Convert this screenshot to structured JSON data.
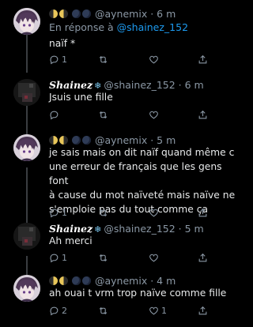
{
  "tweets": [
    {
      "kind": "aynemix",
      "handle": "@aynemix",
      "time": "· 6 m",
      "reply_prefix": "En réponse à ",
      "reply_to": "@shainez_152",
      "text": "naïf *",
      "reply_count": "1",
      "retweet_count": "",
      "like_count": ""
    },
    {
      "kind": "shainez",
      "display_name": "Shainez",
      "handle": "@shainez_152",
      "time": "· 6 m",
      "text": "Jsuis une fille",
      "reply_count": "",
      "retweet_count": "",
      "like_count": ""
    },
    {
      "kind": "aynemix",
      "handle": "@aynemix",
      "time": "· 5 m",
      "lines": [
        "je sais mais on dit naïf quand même c",
        "une erreur de français que les gens font",
        "à cause du mot naïveté mais naïve ne",
        "s'emploie pas du tout comme ça"
      ],
      "reply_count": "1",
      "retweet_count": "",
      "like_count": ""
    },
    {
      "kind": "shainez",
      "display_name": "Shainez",
      "handle": "@shainez_152",
      "time": "· 5 m",
      "text": "Ah merci",
      "reply_count": "1",
      "retweet_count": "",
      "like_count": ""
    },
    {
      "kind": "aynemix",
      "handle": "@aynemix",
      "time": "· 4 m",
      "text": "ah ouai t vrm trop naïve comme fille",
      "reply_count": "2",
      "retweet_count": "",
      "like_count": "1"
    }
  ],
  "icons": {
    "reply": "reply-icon",
    "retweet": "retweet-icon",
    "like": "heart-icon",
    "share": "share-icon",
    "snowflake": "snowflake-icon",
    "moon": "moon-icon"
  },
  "colors": {
    "link": "#1d9bf0",
    "muted": "#8b98a5",
    "text": "#e7e9ea",
    "background": "#000000"
  }
}
